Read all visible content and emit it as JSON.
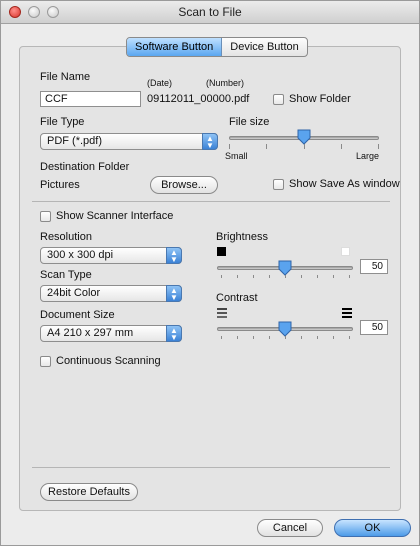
{
  "window": {
    "title": "Scan to File"
  },
  "tabs": [
    {
      "label": "Software Button",
      "active": true
    },
    {
      "label": "Device Button",
      "active": false
    }
  ],
  "file_name": {
    "label": "File Name",
    "date_hint": "(Date)",
    "number_hint": "(Number)",
    "value": "CCF",
    "generated_name": "09112011_00000.pdf",
    "show_folder_label": "Show Folder",
    "show_folder_checked": false
  },
  "file_type": {
    "label": "File Type",
    "value": "PDF (*.pdf)"
  },
  "file_size": {
    "label": "File size",
    "min_label": "Small",
    "max_label": "Large",
    "level_fraction": 0.5
  },
  "destination": {
    "label": "Destination Folder",
    "value": "Pictures",
    "browse_label": "Browse...",
    "save_as_label": "Show Save As window",
    "save_as_checked": false
  },
  "scanner": {
    "show_interface_label": "Show Scanner Interface",
    "show_interface_checked": false
  },
  "resolution": {
    "label": "Resolution",
    "value": "300 x 300 dpi"
  },
  "scan_type": {
    "label": "Scan Type",
    "value": "24bit Color"
  },
  "document_size": {
    "label": "Document Size",
    "value": "A4 210 x 297 mm"
  },
  "continuous": {
    "label": "Continuous Scanning",
    "checked": false
  },
  "brightness": {
    "label": "Brightness",
    "value": "50"
  },
  "contrast": {
    "label": "Contrast",
    "value": "50"
  },
  "buttons": {
    "restore": "Restore Defaults",
    "cancel": "Cancel",
    "ok": "OK"
  },
  "colors": {
    "accent": "#4c9be8",
    "close": "#d8342b"
  }
}
